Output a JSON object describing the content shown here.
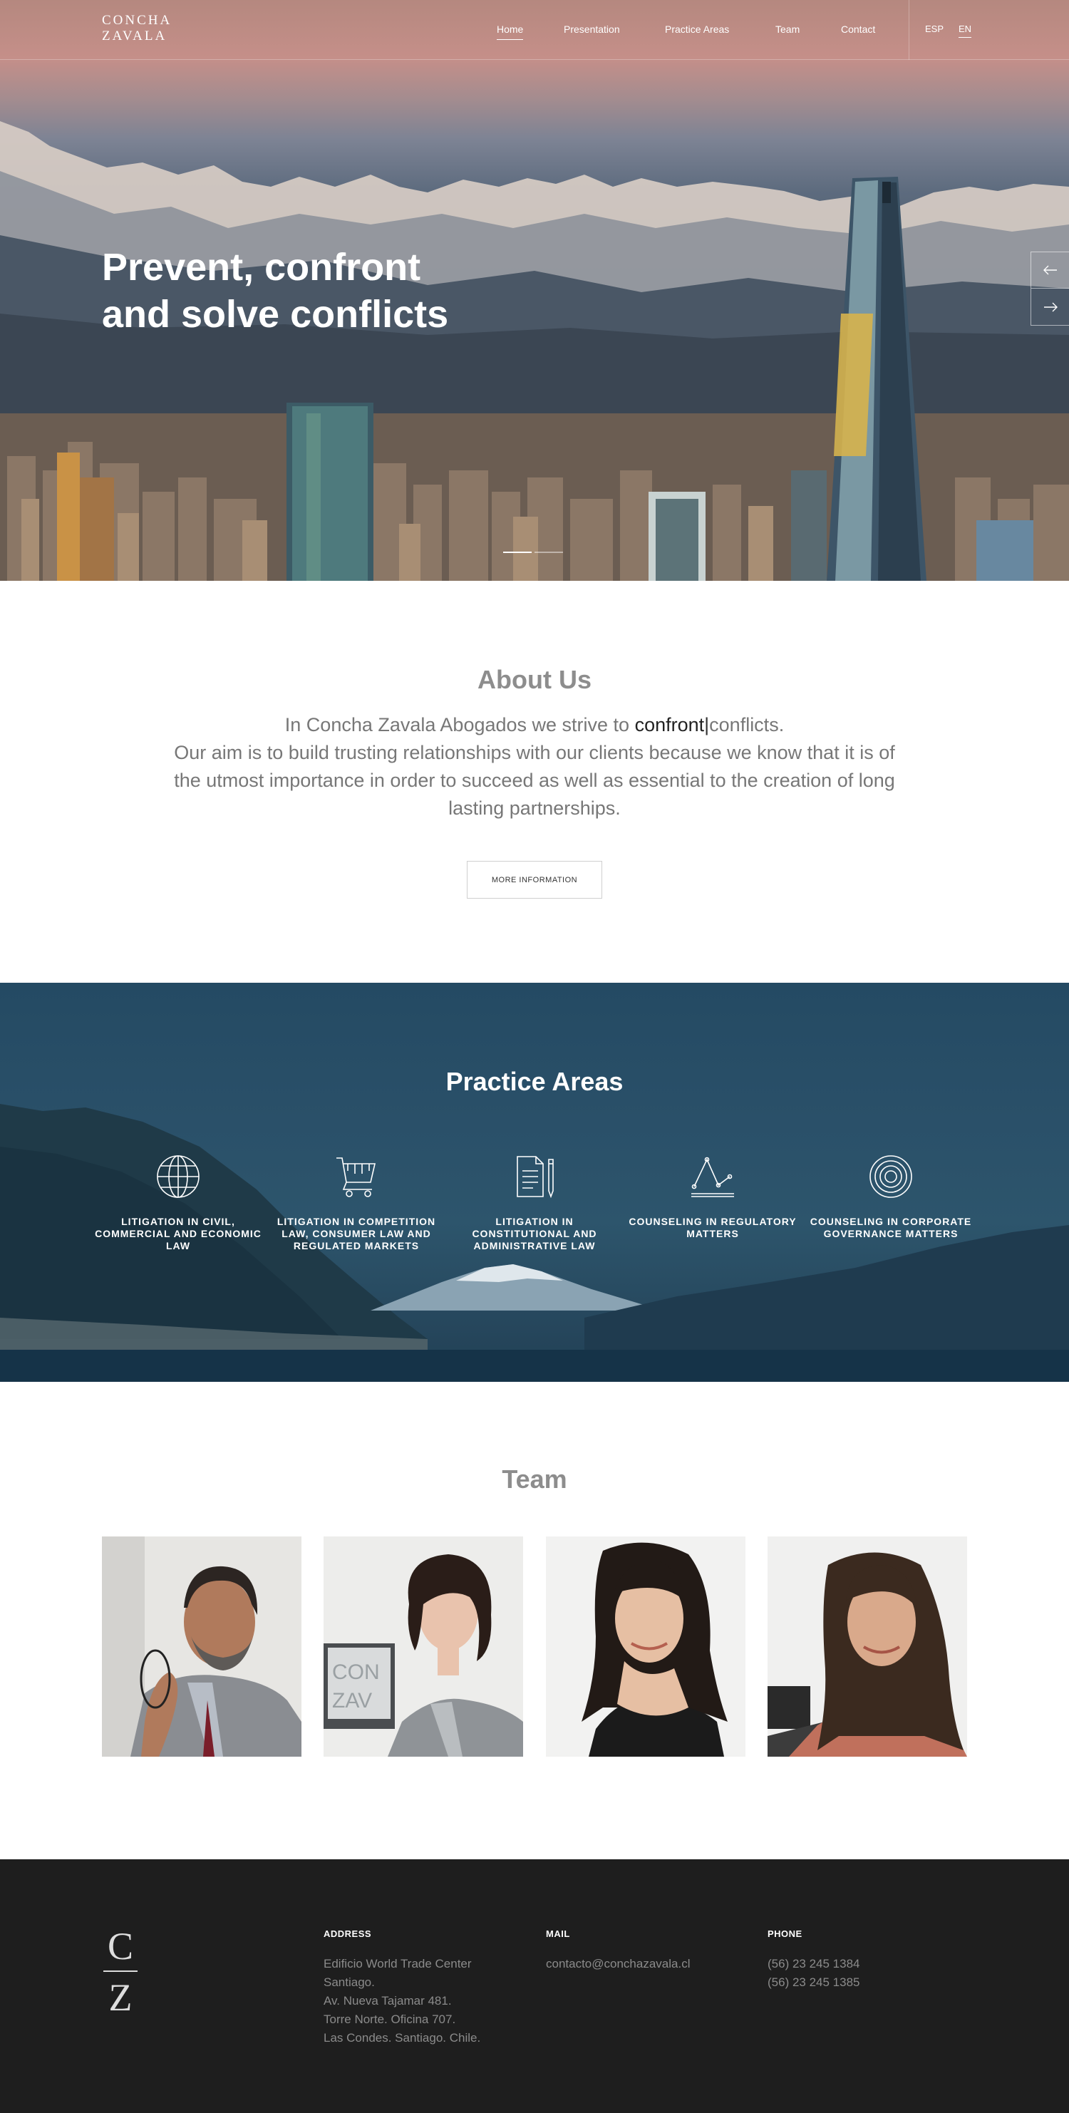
{
  "header": {
    "logo_line1": "CONCHA",
    "logo_line2": "ZAVALA",
    "nav": [
      "Home",
      "Presentation",
      "Practice Areas",
      "Team",
      "Contact"
    ],
    "active_nav": "Home",
    "languages": [
      "ESP",
      "EN"
    ],
    "active_language": "EN"
  },
  "hero": {
    "title_line1": "Prevent, confront",
    "title_line2": "and solve conflicts",
    "prev_icon": "arrow-left-icon",
    "next_icon": "arrow-right-icon",
    "slides": 2,
    "active_slide": 1
  },
  "about": {
    "title": "About Us",
    "text_before": "In Concha Zavala Abogados we strive to ",
    "highlight": "confront",
    "caret": "|",
    "text_after": "conflicts.",
    "line2": "Our aim is to build trusting relationships with our clients because we know that it is of the utmost importance in order to succeed as well as essential to the creation of long lasting partnerships.",
    "button": "MORE INFORMATION"
  },
  "practice": {
    "title": "Practice Areas",
    "items": [
      {
        "icon": "globe-icon",
        "label": "LITIGATION IN CIVIL, COMMERCIAL AND ECONOMIC LAW"
      },
      {
        "icon": "shopping-cart-icon",
        "label": "LITIGATION IN COMPETITION LAW, CONSUMER LAW AND REGULATED MARKETS"
      },
      {
        "icon": "document-pen-icon",
        "label": "LITIGATION IN CONSTITUTIONAL AND ADMINISTRATIVE LAW"
      },
      {
        "icon": "line-chart-icon",
        "label": "COUNSELING IN REGULATORY MATTERS"
      },
      {
        "icon": "target-icon",
        "label": "COUNSELING IN CORPORATE GOVERNANCE MATTERS"
      }
    ]
  },
  "team": {
    "title": "Team"
  },
  "footer": {
    "logo_top": "C",
    "logo_bottom": "Z",
    "address_title": "ADDRESS",
    "address_lines": [
      "Edificio World Trade Center",
      "Santiago.",
      "Av. Nueva Tajamar 481.",
      "Torre Norte. Oficina 707.",
      "Las Condes. Santiago. Chile."
    ],
    "mail_title": "MAIL",
    "mail": "contacto@conchazavala.cl",
    "phone_title": "PHONE",
    "phones": [
      "(56) 23 245 1384",
      "(56) 23 245 1385"
    ]
  }
}
